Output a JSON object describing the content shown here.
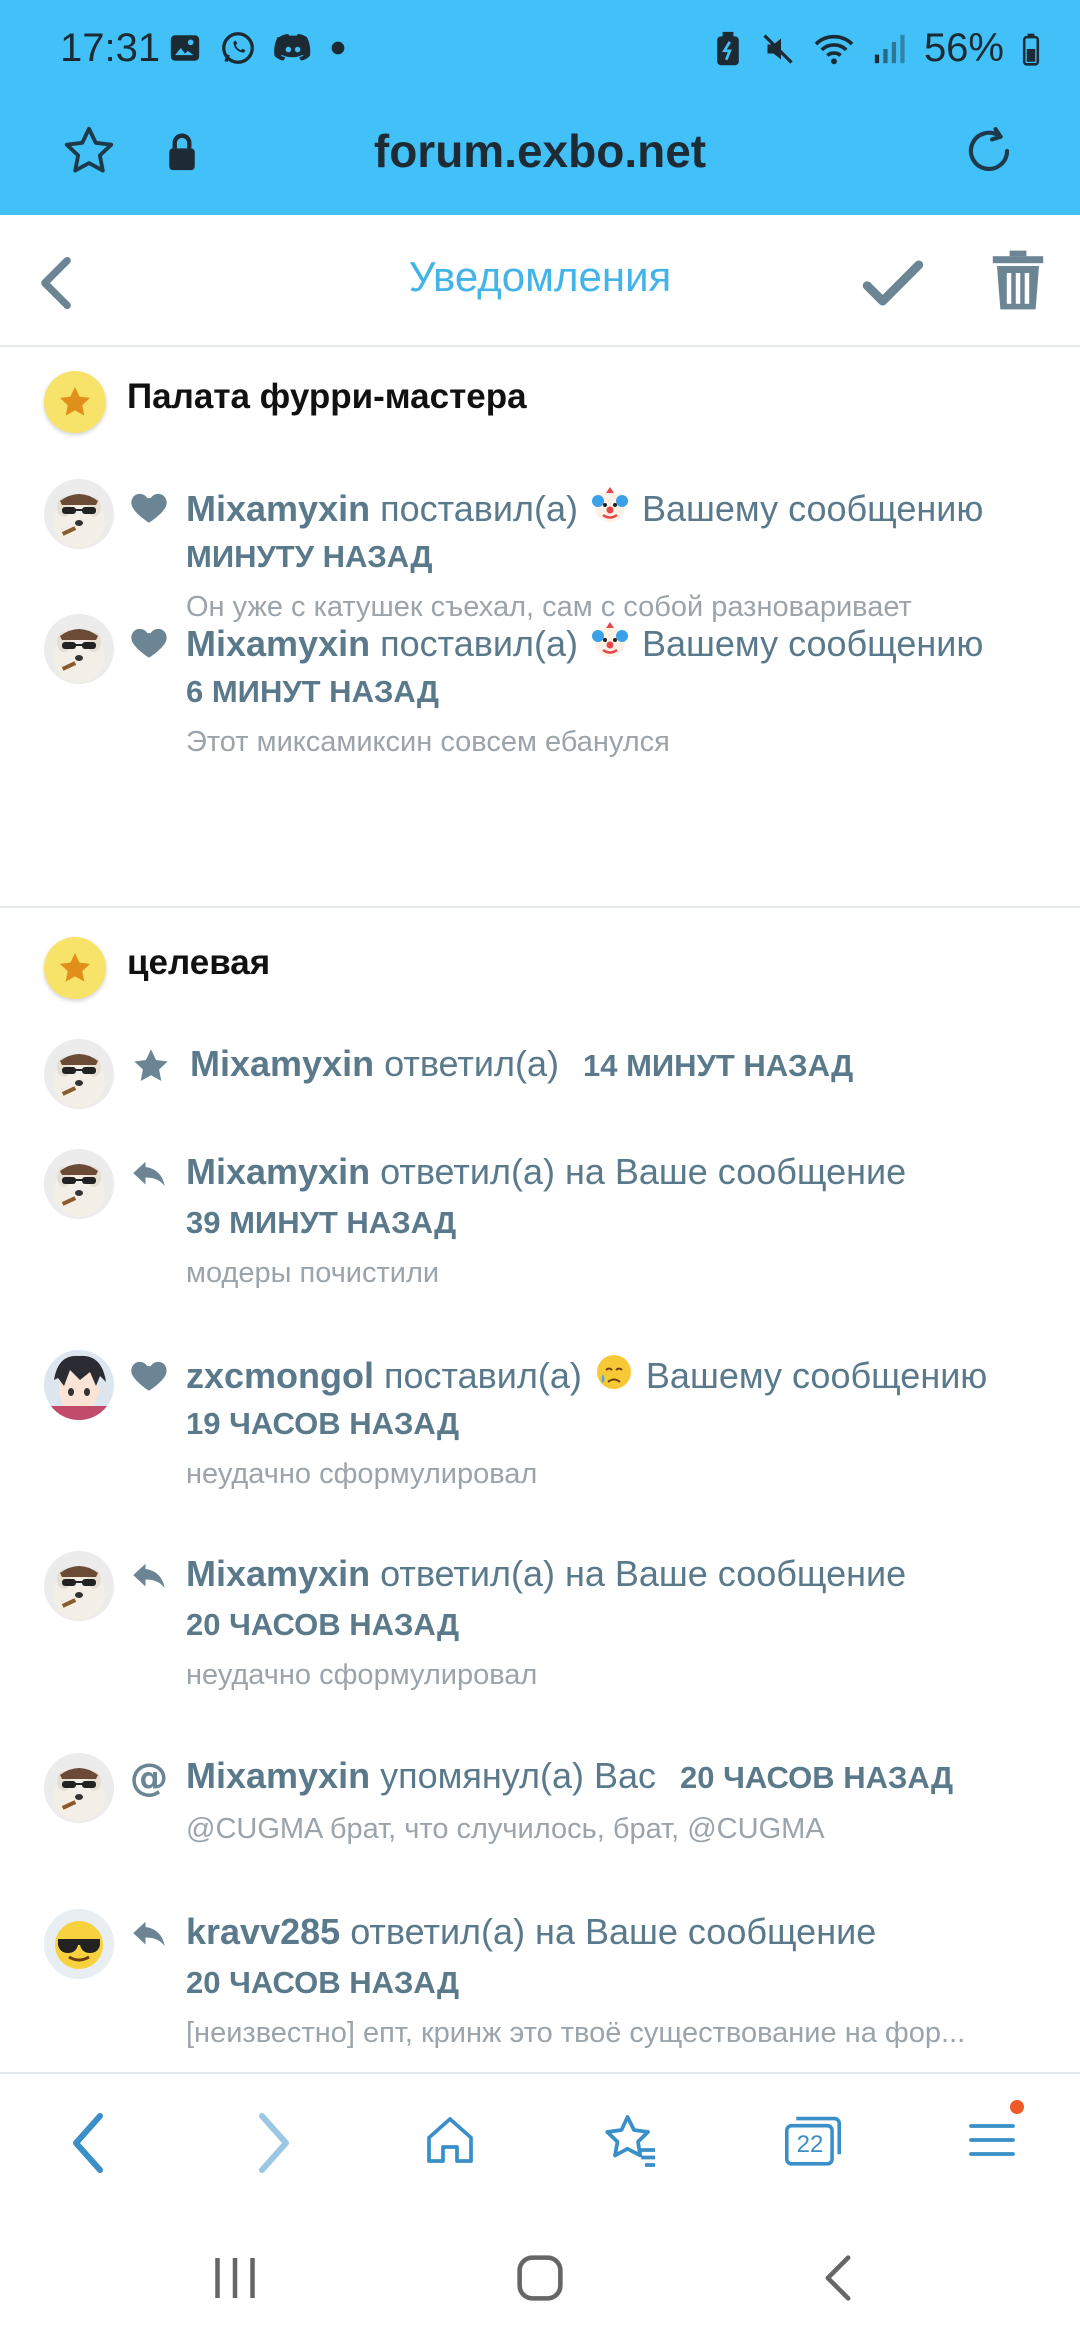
{
  "status": {
    "time": "17:31",
    "battery": "56%"
  },
  "browser": {
    "url": "forum.exbo.net",
    "tabs_count": "22"
  },
  "page": {
    "title": "Уведомления"
  },
  "groups": [
    {
      "title": "Палата фурри-мастера",
      "notifications": [
        {
          "user": "Mixamyxin",
          "action": "поставил(а)",
          "emoji": "clown",
          "target": "Вашему сообщению",
          "time": "МИНУТУ НАЗАД",
          "excerpt": "Он уже с катушек съехал, сам с собой разноваривает"
        },
        {
          "user": "Mixamyxin",
          "action": "поставил(а)",
          "emoji": "clown",
          "target": "Вашему сообщению",
          "time": "6 МИНУТ НАЗАД",
          "excerpt": "Этот миксамиксин совсем ебанулся"
        }
      ]
    },
    {
      "title": "целевая",
      "notifications": [
        {
          "user": "Mixamyxin",
          "action": "ответил(а)",
          "time": "14 МИНУТ НАЗАД"
        },
        {
          "user": "Mixamyxin",
          "action": "ответил(а) на Ваше сообщение",
          "time": "39 МИНУТ НАЗАД",
          "excerpt": "модеры почистили"
        },
        {
          "user": "zxcmongol",
          "action": "поставил(а)",
          "emoji": "sad-face",
          "target": "Вашему сообщению",
          "time": "19 ЧАСОВ НАЗАД",
          "excerpt": "неудачно сформулировал"
        },
        {
          "user": "Mixamyxin",
          "action": "ответил(а) на Ваше сообщение",
          "time": "20 ЧАСОВ НАЗАД",
          "excerpt": "неудачно сформулировал"
        },
        {
          "user": "Mixamyxin",
          "action": "упомянул(а) Вас",
          "time": "20 ЧАСОВ НАЗАД",
          "excerpt": "@CUGMA брат, что случилось, брат, @CUGMA"
        },
        {
          "user": "kravv285",
          "action": "ответил(а) на Ваше сообщение",
          "time": "20 ЧАСОВ НАЗАД",
          "excerpt": "[неизвестно] епт, кринж это твоё существование на фор..."
        }
      ]
    }
  ],
  "colors": {
    "topbar": "#42c0f8",
    "accent": "#42b4e8",
    "text_meta": "#5a7a8c",
    "excerpt": "#9aa4aa",
    "icon_dark": "#6b8594",
    "notification_dot": "#f05a28"
  }
}
